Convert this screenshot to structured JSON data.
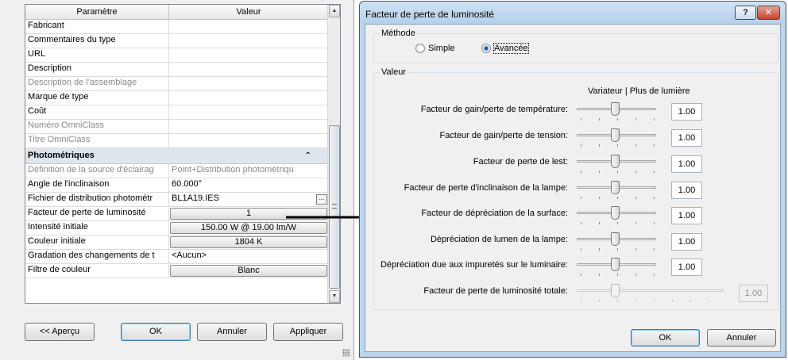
{
  "left": {
    "headers": {
      "name": "Paramètre",
      "value": "Valeur"
    },
    "rows_top": [
      {
        "name": "Fabricant",
        "value": "",
        "disabled": false
      },
      {
        "name": "Commentaires du type",
        "value": "",
        "disabled": false
      },
      {
        "name": "URL",
        "value": "",
        "disabled": false
      },
      {
        "name": "Description",
        "value": "",
        "disabled": false
      },
      {
        "name": "Description de l'assemblage",
        "value": "",
        "disabled": true
      },
      {
        "name": "Marque de type",
        "value": "",
        "disabled": false
      },
      {
        "name": "Coût",
        "value": "",
        "disabled": false
      },
      {
        "name": "Numéro OmniClass",
        "value": "",
        "disabled": true
      },
      {
        "name": "Titre OmniClass",
        "value": "",
        "disabled": true
      }
    ],
    "group": {
      "label": "Photométriques",
      "chevron": "⌃"
    },
    "rows_group": [
      {
        "name": "Définition de la source d'éclairag",
        "value": "Point+Distribution photométriqu",
        "disabled": true
      },
      {
        "name": "Angle de l'inclinaison",
        "value": "60.000°"
      },
      {
        "name": "Fichier de distribution photométr",
        "value": "BL1A19.IES",
        "ellipsis": "..."
      },
      {
        "name": "Facteur de perte de luminosité",
        "value": "1",
        "button": true
      },
      {
        "name": "Intensité initiale",
        "value": "150.00 W @ 19.00 lm/W",
        "button": true
      },
      {
        "name": "Couleur initiale",
        "value": "1804 K",
        "button": true
      },
      {
        "name": "Gradation des changements de t",
        "value": "<Aucun>"
      },
      {
        "name": "Filtre de couleur",
        "value": "Blanc",
        "button": true
      }
    ],
    "buttons": {
      "preview": "<< Aperçu",
      "ok": "OK",
      "cancel": "Annuler",
      "apply": "Appliquer"
    }
  },
  "dialog": {
    "title": "Facteur de perte de luminosité",
    "help_label": "?",
    "close_label": "✕",
    "method": {
      "legend": "Méthode",
      "options": [
        {
          "label": "Simple",
          "selected": false
        },
        {
          "label": "Avancée",
          "selected": true
        }
      ]
    },
    "value_group": {
      "legend": "Valeur",
      "range_label": "Variateur  |  Plus de lumière",
      "factors": [
        {
          "label": "Facteur de gain/perte de température:",
          "value": "1.00"
        },
        {
          "label": "Facteur de gain/perte de tension:",
          "value": "1.00"
        },
        {
          "label": "Facteur de perte de lest:",
          "value": "1.00"
        },
        {
          "label": "Facteur de perte d'inclinaison de la lampe:",
          "value": "1.00"
        },
        {
          "label": "Facteur de dépréciation de la surface:",
          "value": "1.00"
        },
        {
          "label": "Dépréciation de lumen de la lampe:",
          "value": "1.00"
        },
        {
          "label": "Dépréciation due aux impuretés sur le luminaire:",
          "value": "1.00"
        }
      ],
      "total": {
        "label": "Facteur de perte de luminosité totale:",
        "value": "1.00"
      }
    },
    "buttons": {
      "ok": "OK",
      "cancel": "Annuler"
    }
  }
}
